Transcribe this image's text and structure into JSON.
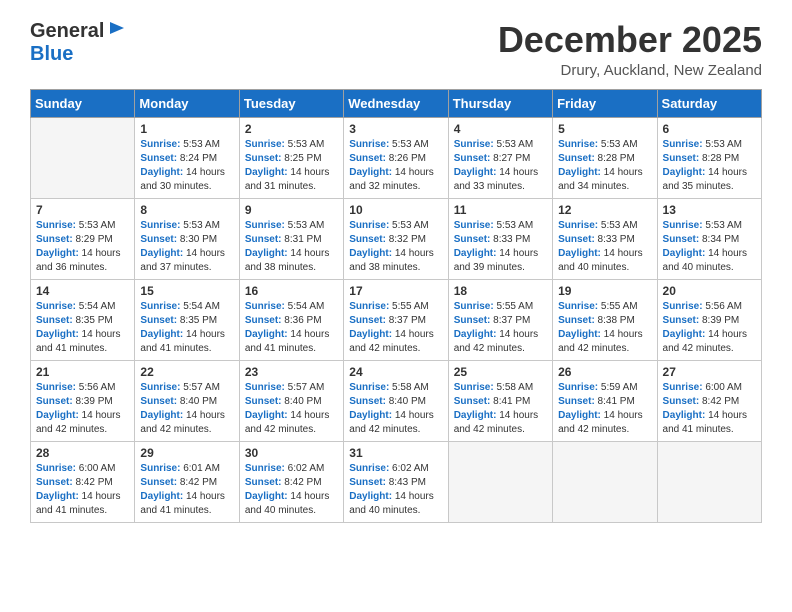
{
  "header": {
    "logo_line1": "General",
    "logo_line2": "Blue",
    "month_title": "December 2025",
    "location": "Drury, Auckland, New Zealand"
  },
  "weekdays": [
    "Sunday",
    "Monday",
    "Tuesday",
    "Wednesday",
    "Thursday",
    "Friday",
    "Saturday"
  ],
  "weeks": [
    [
      {
        "day": "",
        "sunrise": "",
        "sunset": "",
        "daylight": "",
        "empty": true
      },
      {
        "day": "1",
        "sunrise": "5:53 AM",
        "sunset": "8:24 PM",
        "hours": "14",
        "minutes": "30"
      },
      {
        "day": "2",
        "sunrise": "5:53 AM",
        "sunset": "8:25 PM",
        "hours": "14",
        "minutes": "31"
      },
      {
        "day": "3",
        "sunrise": "5:53 AM",
        "sunset": "8:26 PM",
        "hours": "14",
        "minutes": "32"
      },
      {
        "day": "4",
        "sunrise": "5:53 AM",
        "sunset": "8:27 PM",
        "hours": "14",
        "minutes": "33"
      },
      {
        "day": "5",
        "sunrise": "5:53 AM",
        "sunset": "8:28 PM",
        "hours": "14",
        "minutes": "34"
      },
      {
        "day": "6",
        "sunrise": "5:53 AM",
        "sunset": "8:28 PM",
        "hours": "14",
        "minutes": "35"
      }
    ],
    [
      {
        "day": "7",
        "sunrise": "5:53 AM",
        "sunset": "8:29 PM",
        "hours": "14",
        "minutes": "36"
      },
      {
        "day": "8",
        "sunrise": "5:53 AM",
        "sunset": "8:30 PM",
        "hours": "14",
        "minutes": "37"
      },
      {
        "day": "9",
        "sunrise": "5:53 AM",
        "sunset": "8:31 PM",
        "hours": "14",
        "minutes": "38"
      },
      {
        "day": "10",
        "sunrise": "5:53 AM",
        "sunset": "8:32 PM",
        "hours": "14",
        "minutes": "38"
      },
      {
        "day": "11",
        "sunrise": "5:53 AM",
        "sunset": "8:33 PM",
        "hours": "14",
        "minutes": "39"
      },
      {
        "day": "12",
        "sunrise": "5:53 AM",
        "sunset": "8:33 PM",
        "hours": "14",
        "minutes": "40"
      },
      {
        "day": "13",
        "sunrise": "5:53 AM",
        "sunset": "8:34 PM",
        "hours": "14",
        "minutes": "40"
      }
    ],
    [
      {
        "day": "14",
        "sunrise": "5:54 AM",
        "sunset": "8:35 PM",
        "hours": "14",
        "minutes": "41"
      },
      {
        "day": "15",
        "sunrise": "5:54 AM",
        "sunset": "8:35 PM",
        "hours": "14",
        "minutes": "41"
      },
      {
        "day": "16",
        "sunrise": "5:54 AM",
        "sunset": "8:36 PM",
        "hours": "14",
        "minutes": "41"
      },
      {
        "day": "17",
        "sunrise": "5:55 AM",
        "sunset": "8:37 PM",
        "hours": "14",
        "minutes": "42"
      },
      {
        "day": "18",
        "sunrise": "5:55 AM",
        "sunset": "8:37 PM",
        "hours": "14",
        "minutes": "42"
      },
      {
        "day": "19",
        "sunrise": "5:55 AM",
        "sunset": "8:38 PM",
        "hours": "14",
        "minutes": "42"
      },
      {
        "day": "20",
        "sunrise": "5:56 AM",
        "sunset": "8:39 PM",
        "hours": "14",
        "minutes": "42"
      }
    ],
    [
      {
        "day": "21",
        "sunrise": "5:56 AM",
        "sunset": "8:39 PM",
        "hours": "14",
        "minutes": "42"
      },
      {
        "day": "22",
        "sunrise": "5:57 AM",
        "sunset": "8:40 PM",
        "hours": "14",
        "minutes": "42"
      },
      {
        "day": "23",
        "sunrise": "5:57 AM",
        "sunset": "8:40 PM",
        "hours": "14",
        "minutes": "42"
      },
      {
        "day": "24",
        "sunrise": "5:58 AM",
        "sunset": "8:40 PM",
        "hours": "14",
        "minutes": "42"
      },
      {
        "day": "25",
        "sunrise": "5:58 AM",
        "sunset": "8:41 PM",
        "hours": "14",
        "minutes": "42"
      },
      {
        "day": "26",
        "sunrise": "5:59 AM",
        "sunset": "8:41 PM",
        "hours": "14",
        "minutes": "42"
      },
      {
        "day": "27",
        "sunrise": "6:00 AM",
        "sunset": "8:42 PM",
        "hours": "14",
        "minutes": "41"
      }
    ],
    [
      {
        "day": "28",
        "sunrise": "6:00 AM",
        "sunset": "8:42 PM",
        "hours": "14",
        "minutes": "41"
      },
      {
        "day": "29",
        "sunrise": "6:01 AM",
        "sunset": "8:42 PM",
        "hours": "14",
        "minutes": "41"
      },
      {
        "day": "30",
        "sunrise": "6:02 AM",
        "sunset": "8:42 PM",
        "hours": "14",
        "minutes": "40"
      },
      {
        "day": "31",
        "sunrise": "6:02 AM",
        "sunset": "8:43 PM",
        "hours": "14",
        "minutes": "40"
      },
      {
        "day": "",
        "sunrise": "",
        "sunset": "",
        "hours": "",
        "minutes": "",
        "empty": true
      },
      {
        "day": "",
        "sunrise": "",
        "sunset": "",
        "hours": "",
        "minutes": "",
        "empty": true
      },
      {
        "day": "",
        "sunrise": "",
        "sunset": "",
        "hours": "",
        "minutes": "",
        "empty": true
      }
    ]
  ],
  "labels": {
    "sunrise": "Sunrise:",
    "sunset": "Sunset:",
    "daylight": "Daylight:"
  }
}
